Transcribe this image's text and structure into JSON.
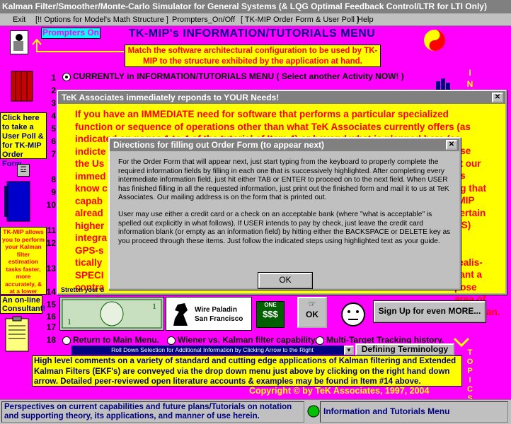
{
  "window": {
    "title": "Kalman Filter/Smoother/Monte-Carlo Simulator for General Systems (& LQG Optimal Feedback Control/LTR for LTI Only)"
  },
  "menu": [
    "Exit",
    "[!! Options for Model's Math Structure ]",
    "Prompters_On/Off",
    "[ TK-MIP Order Form & User Poll ]",
    "Help"
  ],
  "header": {
    "prompters": "Prompters On",
    "title": "TK-MIP's INFORMATION/TUTORIALS MENU",
    "instruction": "Match the software architectural configuration to be used by TK-MIP to the structure exhibited by the application at hand."
  },
  "side": {
    "poll": "Click here to take a User Poll & for TK-MIP Order Form",
    "tkmip": "TK-MIP allows you to perform your Kalman filter estimation tasks faster, more accurately, & at a lower cost!",
    "consultant": "An on-line Consultant!",
    "stretch": "Stretch your d",
    "vertical_letters": [
      "I",
      "N",
      "G"
    ],
    "topics_letters": [
      "T",
      "O",
      "P",
      "I",
      "C",
      "S"
    ]
  },
  "menu_items": {
    "item1": "CURRENTLY in INFORMATION/TUTORIALS MENU ( Select another Activity NOW! )",
    "numbers": [
      "1",
      "2",
      "3",
      "4",
      "5",
      "6",
      "7",
      "8",
      "9",
      "10",
      "11",
      "12",
      "13",
      "14",
      "15",
      "16",
      "17",
      "18"
    ],
    "return_main": "Return to Main Menu.",
    "wiener": "Wiener vs. Kalman filter capability.",
    "multitarget": "Multi-Target Tracking history."
  },
  "bottom": {
    "rolldown": "Roll Down Selection for Additional Information by Clicking Arrow to the Right",
    "defining": "Defining Terminology",
    "comments": "High level comments on a variety of standard and cutting edge applications of Kalman filtering and Extended Kalman Filters (EKF's) are conveyed via the drop down menu just above by clicking on the right hand down arrow. Detailed peer-reviewed open literature accounts & examples may be found in Item #14 above.",
    "copyright": "Copyright © by TeK Associates, 1997, 2004",
    "signup": "Sign Up for even MORE...",
    "ok": "OK",
    "wire_paladin": "Wire Paladin",
    "san_francisco": "San Francisco",
    "one": "ONE",
    "dollars": "$$$"
  },
  "behind_dialog": {
    "title": "TeK Associates immediately reponds to YOUR Needs!",
    "lines": [
      "If you have an IMMEDIATE need for software that  performs a particular specialized",
      "function or sequence of operations other than what TeK Associates currently offers (as",
      "indicated on pages 1 to 4 of the tutorial of Item 4) or beyond what is planned here (as",
      "indicte",
      "the Us",
      "immed",
      "know c",
      "capab",
      "alread",
      "higher",
      "integra",
      "GPS-s",
      "tically",
      "SPECI",
      "contra",
      "specia"
    ],
    "right_frag": [
      "use",
      "et our",
      "us",
      "ng that",
      "-MIP",
      "certain",
      "NS)",
      "realis-",
      "vant a",
      "pose",
      "area of",
      "& Fortran."
    ]
  },
  "dialog": {
    "title": "Directions for filling out Order Form (to appear next)",
    "p1": "For the Order Form that will appear next, just start typing from the keyboard to properly complete the required information fields by filling in each one that is successively highlighted. After completing every intermediate information field, just hit either TAB or ENTER to proceed on to the next field. When USER has finished filling in all the requested information, just print out the finished form and mail it to us at TeK Associates. Our mailing address is on the form that is printed out.",
    "p2": "User may use either a credit card or a check on an acceptable bank (where \"what is acceptable\" is spelled out explicitly in what follows). If USER intends to pay by check, just leave the credit card information blank (or empty as an information field) by hitting either the BACKSPACE or DELETE key as you proceed through these items. Just follow the indicated steps using highlighted text as your guide.",
    "ok": "OK"
  },
  "status": {
    "left": "Perspectives on current capabilities and future plans/Tutorials on notation and supporting theory, its applications, and manner of use herein.",
    "right": "Information and Tutorials Menu"
  }
}
